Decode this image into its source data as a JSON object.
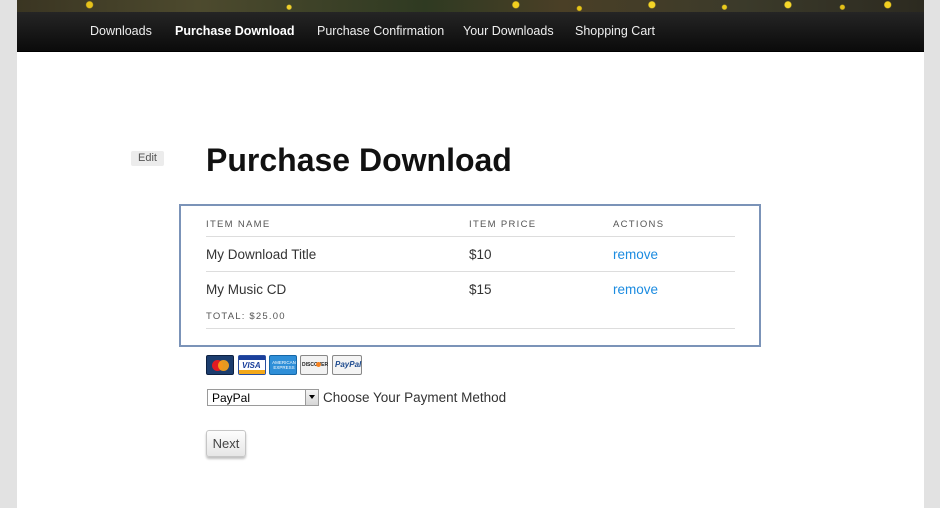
{
  "nav": {
    "items": [
      {
        "label": "Downloads"
      },
      {
        "label": "Purchase Download"
      },
      {
        "label": "Purchase Confirmation"
      },
      {
        "label": "Your Downloads"
      },
      {
        "label": "Shopping Cart"
      }
    ],
    "active": "Purchase Download"
  },
  "edit_label": "Edit",
  "page_title": "Purchase Download",
  "cart": {
    "columns": [
      "ITEM NAME",
      "ITEM PRICE",
      "ACTIONS"
    ],
    "rows": [
      {
        "name": "My Download Title",
        "price": "$10",
        "action": "remove"
      },
      {
        "name": "My Music CD",
        "price": "$15",
        "action": "remove"
      }
    ],
    "total": "TOTAL: $25.00"
  },
  "payment_icons": [
    "mastercard-icon",
    "visa-icon",
    "american-express-icon",
    "discover-icon",
    "paypal-icon"
  ],
  "payment_icon_text": {
    "visa": "VISA",
    "amex": "AMERICAN EXPRESS",
    "discover": "DISCOVER",
    "paypal": "PayPal"
  },
  "payment": {
    "selected": "PayPal",
    "label": "Choose Your Payment Method"
  },
  "next_label": "Next",
  "colors": {
    "link": "#1b8be0",
    "cart_border": "#7b93b8",
    "navbar": "#111111"
  }
}
